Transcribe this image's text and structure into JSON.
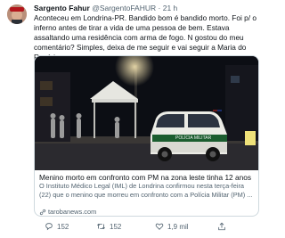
{
  "tweet": {
    "author_name": "Sargento Fahur",
    "handle": "@SargentoFAHUR",
    "separator": "·",
    "time": "21 h",
    "text": "Aconteceu em Londrina-PR. Bandido bom é bandido morto. Foi p/ o inferno antes de tirar a vida de uma pessoa de bem. Estava assaltando uma residência com arma de fogo. N gostou do meu comentário? Simples, deixa de me seguir e vai seguir a Maria do Rosário."
  },
  "card": {
    "title": "Menino morto em confronto com PM na zona leste tinha 12 anos",
    "description_line1": "O Instituto Médico Legal (IML) de Londrina confirmou nesta terça-feira",
    "description_line2": "(22) que o menino que morreu em confronto com a Polícia Militar (PM) ...",
    "link": "tarobanews.com",
    "image_vehicle_text": "POLÍCIA MILITAR"
  },
  "actions": {
    "replies": "152",
    "retweets": "152",
    "likes": "1,9 mil"
  },
  "icons": [
    "avatar",
    "link-icon",
    "reply-icon",
    "retweet-icon",
    "like-icon",
    "share-icon"
  ],
  "colors": {
    "text": "#0f1419",
    "secondary": "#536471",
    "border": "#cfd9de"
  }
}
